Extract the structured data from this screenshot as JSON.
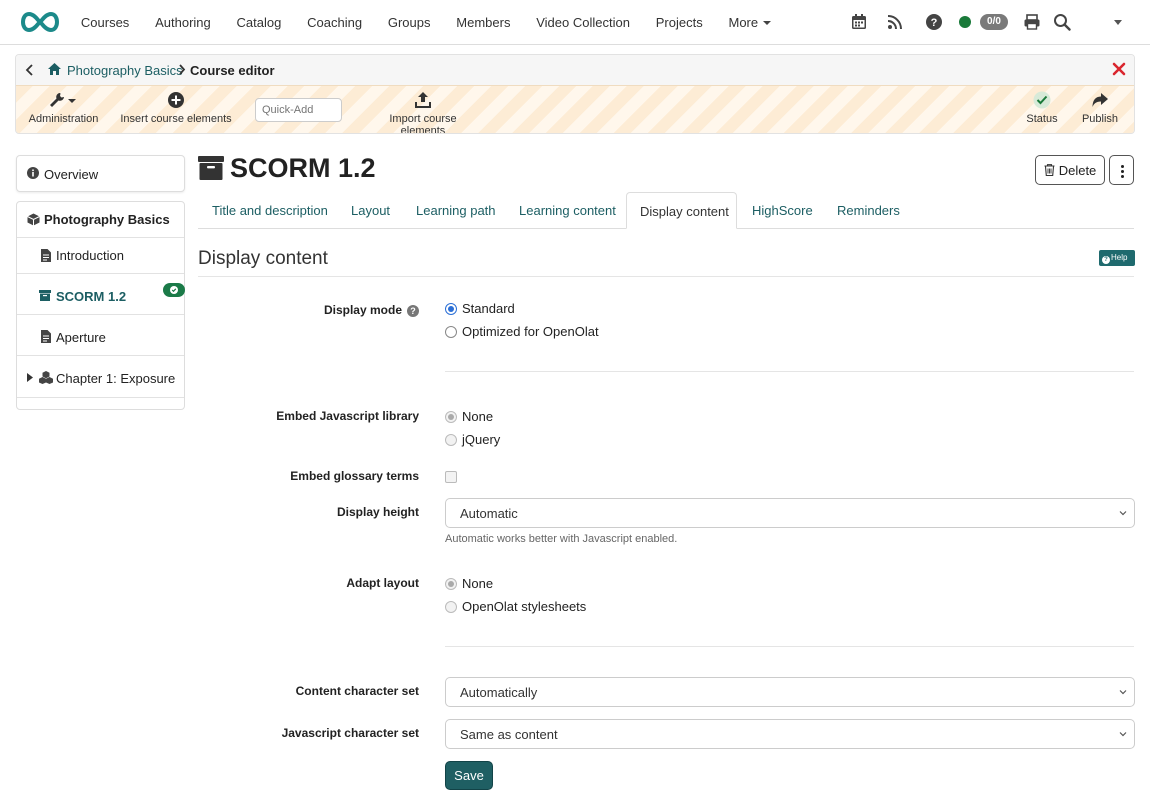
{
  "topnav": {
    "items": [
      "Courses",
      "Authoring",
      "Catalog",
      "Coaching",
      "Groups",
      "Members",
      "Video Collection",
      "Projects",
      "More"
    ],
    "counter": "0/0",
    "colors": {
      "brand": "#1c8a8a",
      "status": "#1a7a3a"
    }
  },
  "editor": {
    "breadcrumb": {
      "course": "Photography Basics",
      "current": "Course editor"
    },
    "tools": {
      "administration": "Administration",
      "insert": "Insert course elements",
      "quickadd_placeholder": "Quick-Add",
      "import": "Import course elements",
      "status": "Status",
      "publish": "Publish"
    }
  },
  "tree": {
    "overview": "Overview",
    "root": "Photography Basics",
    "items": [
      "Introduction",
      "SCORM 1.2",
      "Aperture",
      "Chapter 1: Exposure"
    ]
  },
  "main": {
    "title": "SCORM 1.2",
    "delete_label": "Delete",
    "tabs": [
      "Title and description",
      "Layout",
      "Learning path",
      "Learning content",
      "Display content",
      "HighScore",
      "Reminders"
    ],
    "active_tab": "Display content",
    "section_title": "Display content",
    "help_label": "Help"
  },
  "form": {
    "display_mode": {
      "label": "Display mode",
      "options": [
        "Standard",
        "Optimized for OpenOlat"
      ],
      "selected": "Standard"
    },
    "embed_js": {
      "label": "Embed Javascript library",
      "options": [
        "None",
        "jQuery"
      ],
      "selected": "None"
    },
    "embed_glossary": {
      "label": "Embed glossary terms",
      "checked": false
    },
    "display_height": {
      "label": "Display height",
      "value": "Automatic",
      "hint": "Automatic works better with Javascript enabled."
    },
    "adapt_layout": {
      "label": "Adapt layout",
      "options": [
        "None",
        "OpenOlat stylesheets"
      ],
      "selected": "None"
    },
    "content_charset": {
      "label": "Content character set",
      "value": "Automatically"
    },
    "js_charset": {
      "label": "Javascript character set",
      "value": "Same as content"
    },
    "save_label": "Save"
  }
}
